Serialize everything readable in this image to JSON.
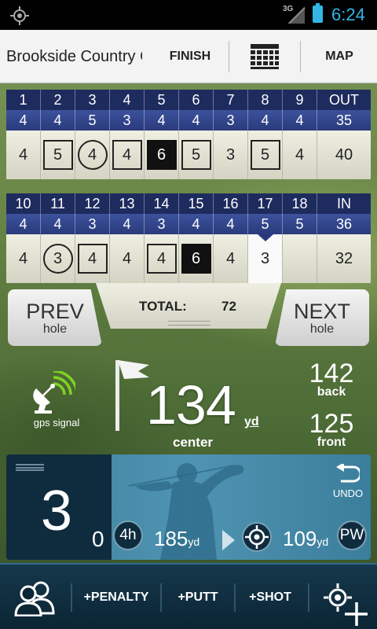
{
  "status_bar": {
    "network": "3G",
    "time": "6:24"
  },
  "top_bar": {
    "course_name": "Brookside Country Club",
    "finish_label": "FINISH",
    "map_label": "MAP"
  },
  "front_nine": {
    "holes": [
      "1",
      "2",
      "3",
      "4",
      "5",
      "6",
      "7",
      "8",
      "9"
    ],
    "total_label": "OUT",
    "pars": [
      "4",
      "4",
      "5",
      "3",
      "4",
      "4",
      "3",
      "4",
      "4"
    ],
    "par_total": "35",
    "scores": [
      "4",
      "5",
      "4",
      "4",
      "6",
      "5",
      "3",
      "5",
      "4"
    ],
    "score_total": "40",
    "markers": [
      "",
      "sq",
      "ci",
      "sq",
      "bl",
      "sq",
      "",
      "sq",
      ""
    ]
  },
  "back_nine": {
    "holes": [
      "10",
      "11",
      "12",
      "13",
      "14",
      "15",
      "16",
      "17",
      "18"
    ],
    "total_label": "IN",
    "pars": [
      "4",
      "4",
      "3",
      "4",
      "3",
      "4",
      "4",
      "5",
      "5"
    ],
    "par_total": "36",
    "scores": [
      "4",
      "3",
      "4",
      "4",
      "4",
      "6",
      "4",
      "3",
      ""
    ],
    "score_total": "32",
    "markers": [
      "",
      "ci",
      "sq",
      "",
      "sq",
      "bl",
      "",
      "",
      ""
    ],
    "current_index": 7
  },
  "navigation": {
    "prev_big": "PREV",
    "prev_small": "hole",
    "next_big": "NEXT",
    "next_small": "hole",
    "total_label": "TOTAL:",
    "total_value": "72"
  },
  "gps": {
    "signal_label": "gps signal",
    "center_distance": "134",
    "center_unit": "yd",
    "center_label": "center",
    "back_distance": "142",
    "back_label": "back",
    "front_distance": "125",
    "front_label": "front"
  },
  "shot_panel": {
    "strokes": "3",
    "putts": "0",
    "undo_label": "UNDO",
    "club1": "4h",
    "club1_distance": "185",
    "unit": "yd",
    "club2": "PW",
    "club2_distance": "109"
  },
  "bottom_bar": {
    "penalty_label": "+PENALTY",
    "putt_label": "+PUTT",
    "shot_label": "+SHOT"
  },
  "colors": {
    "accent": "#33b5e5",
    "header_blue": "#1e2b5e",
    "panel_blue": "#4f94b2",
    "dark_navy": "#0f2c3f"
  }
}
